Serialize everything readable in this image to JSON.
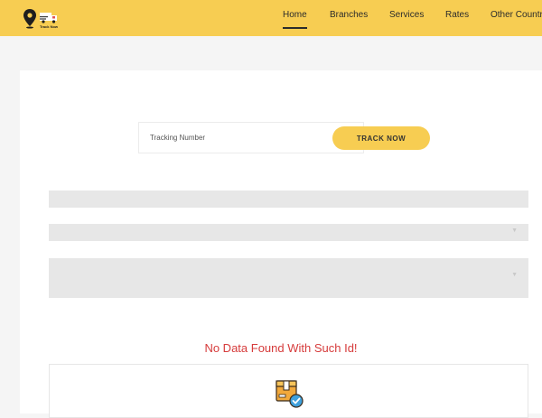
{
  "header": {
    "logo_icon": "map-pin-truck-logo",
    "logo_text": "Track Now",
    "nav": [
      {
        "label": "Home",
        "active": true
      },
      {
        "label": "Branches",
        "active": false
      },
      {
        "label": "Services",
        "active": false
      },
      {
        "label": "Rates",
        "active": false
      },
      {
        "label": "Other Countries",
        "active": false
      }
    ]
  },
  "search": {
    "placeholder": "Tracking Number",
    "value": "",
    "button_label": "TRACK NOW"
  },
  "message": {
    "text": "No Data Found With Such Id!"
  },
  "result_icon": "package-check-icon",
  "colors": {
    "accent": "#f7cd52",
    "error": "#d63b3b",
    "placeholder_bar": "#e7e7e7",
    "page_bg": "#f5f5f5"
  }
}
